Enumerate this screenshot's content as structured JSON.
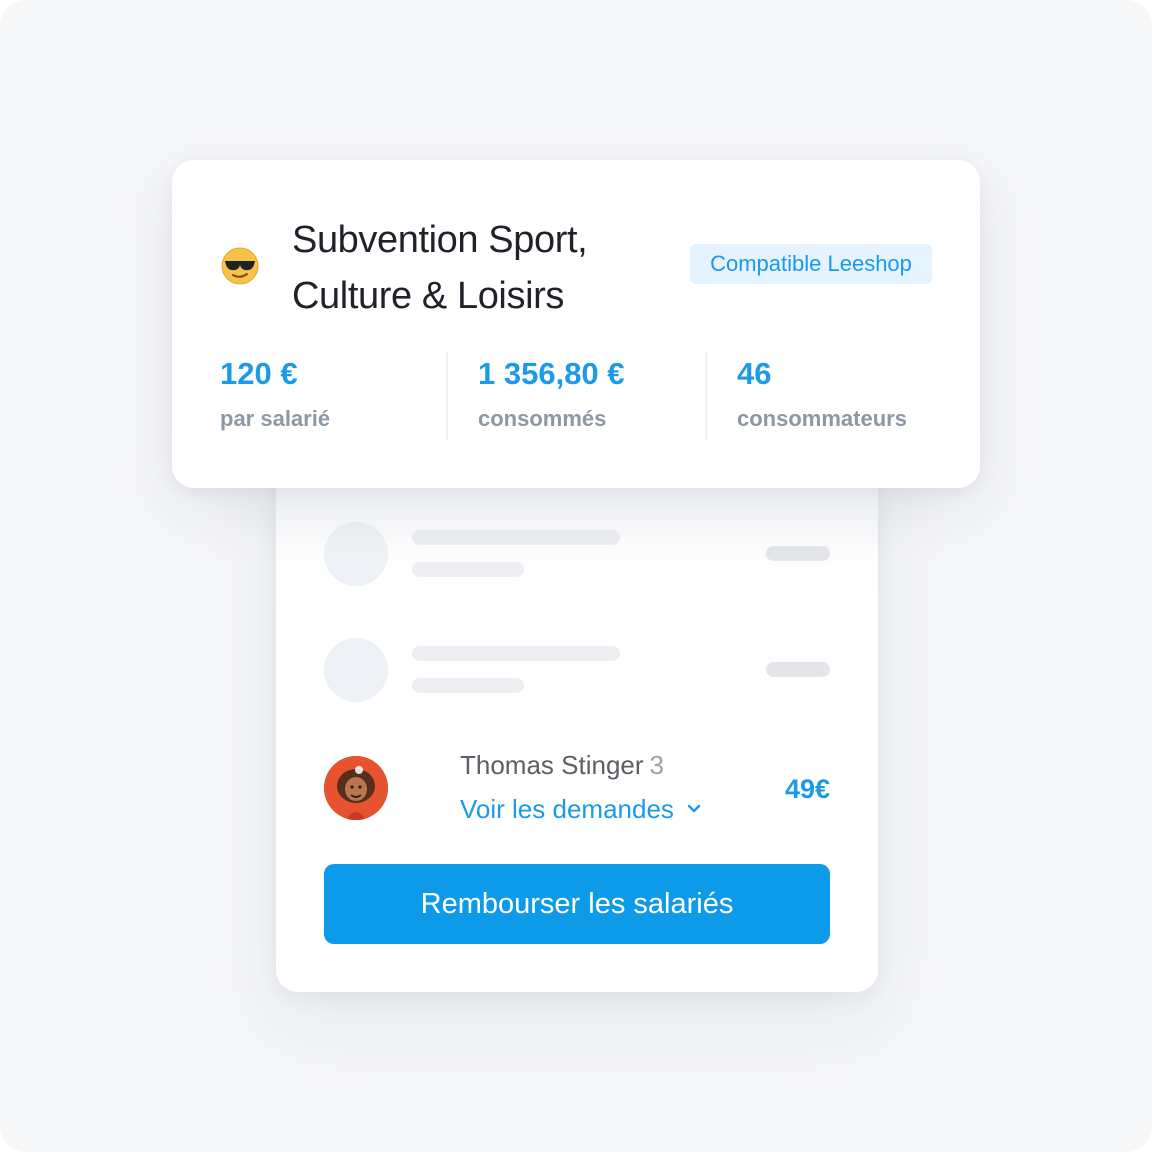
{
  "subsidy": {
    "emoji": "sunglasses-face-emoji",
    "title_line1": "Subvention Sport,",
    "title_line2": "Culture & Loisirs",
    "badge": "Compatible Leeshop",
    "stats": [
      {
        "value": "120 €",
        "label": "par salarié"
      },
      {
        "value": "1 356,80 €",
        "label": "consommés"
      },
      {
        "value": "46",
        "label": "consommateurs"
      }
    ]
  },
  "requests": {
    "placeholder_rows": 2,
    "person": {
      "name": "Thomas Stinger",
      "count": "3",
      "link_label": "Voir les demandes",
      "amount": "49€"
    },
    "cta_label": "Rembourser les salariés"
  },
  "colors": {
    "accent": "#1a9ae8",
    "button": "#0d9ae8",
    "badge_bg": "#e4f3fd",
    "avatar_bg": "#e8532f"
  }
}
